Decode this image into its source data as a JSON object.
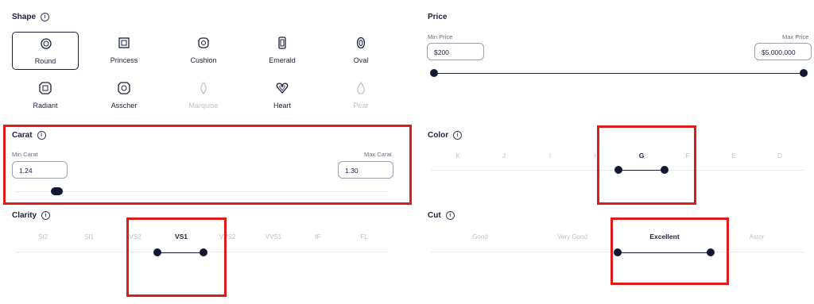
{
  "shape": {
    "title": "Shape",
    "items": [
      {
        "label": "Round",
        "icon": "round-diamond-icon",
        "selected": true,
        "disabled": false
      },
      {
        "label": "Princess",
        "icon": "princess-diamond-icon",
        "selected": false,
        "disabled": false
      },
      {
        "label": "Cushion",
        "icon": "cushion-diamond-icon",
        "selected": false,
        "disabled": false
      },
      {
        "label": "Emerald",
        "icon": "emerald-diamond-icon",
        "selected": false,
        "disabled": false
      },
      {
        "label": "Oval",
        "icon": "oval-diamond-icon",
        "selected": false,
        "disabled": false
      },
      {
        "label": "Radiant",
        "icon": "radiant-diamond-icon",
        "selected": false,
        "disabled": false
      },
      {
        "label": "Asscher",
        "icon": "asscher-diamond-icon",
        "selected": false,
        "disabled": false
      },
      {
        "label": "Marquise",
        "icon": "marquise-diamond-icon",
        "selected": false,
        "disabled": true
      },
      {
        "label": "Heart",
        "icon": "heart-diamond-icon",
        "selected": false,
        "disabled": false
      },
      {
        "label": "Pear",
        "icon": "pear-diamond-icon",
        "selected": false,
        "disabled": true
      }
    ]
  },
  "price": {
    "title": "Price",
    "min_label": "Min Price",
    "max_label": "Max Price",
    "min_value": "$200",
    "max_value": "$5,000,000"
  },
  "carat": {
    "title": "Carat",
    "min_label": "Min Carat",
    "max_label": "Max Carat",
    "min_value": "1.24",
    "max_value": "1.30"
  },
  "color": {
    "title": "Color",
    "grades": [
      "K",
      "J",
      "I",
      "H",
      "G",
      "F",
      "E",
      "D"
    ],
    "selected": "G"
  },
  "clarity": {
    "title": "Clarity",
    "grades": [
      "SI2",
      "SI1",
      "VS2",
      "VS1",
      "VVS2",
      "VVS1",
      "IF",
      "FL"
    ],
    "selected": "VS1"
  },
  "cut": {
    "title": "Cut",
    "grades": [
      "Good",
      "Very Good",
      "Excellent",
      "Astor"
    ],
    "selected": "Excellent"
  },
  "colors": {
    "accent": "#1c1f3f",
    "highlight": "#e01b1b"
  }
}
